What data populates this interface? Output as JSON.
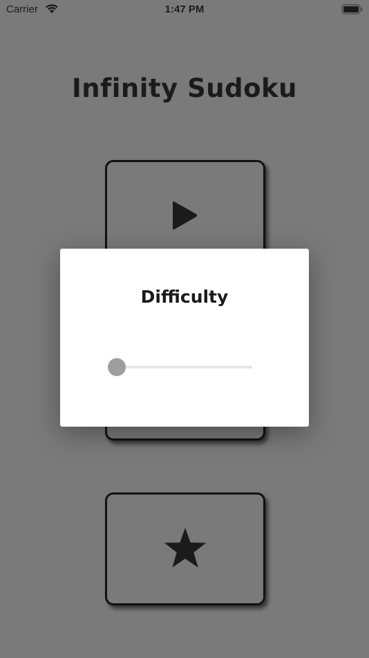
{
  "status_bar": {
    "carrier": "Carrier",
    "time": "1:47 PM",
    "wifi_icon": "wifi-icon",
    "battery_icon": "battery-full-icon"
  },
  "app": {
    "title": "Infinity Sudoku",
    "background_color": "#7a7a7a",
    "text_color": "#1b1b1b"
  },
  "menu": {
    "cards": [
      {
        "icon": "play-icon"
      },
      {
        "icon": ""
      },
      {
        "icon": "star-icon"
      }
    ]
  },
  "dialog": {
    "title": "Difficulty",
    "slider": {
      "value": 0,
      "min": 0,
      "max": 1,
      "thumb_color": "#9e9e9e",
      "track_color": "#e6e6e6"
    }
  }
}
